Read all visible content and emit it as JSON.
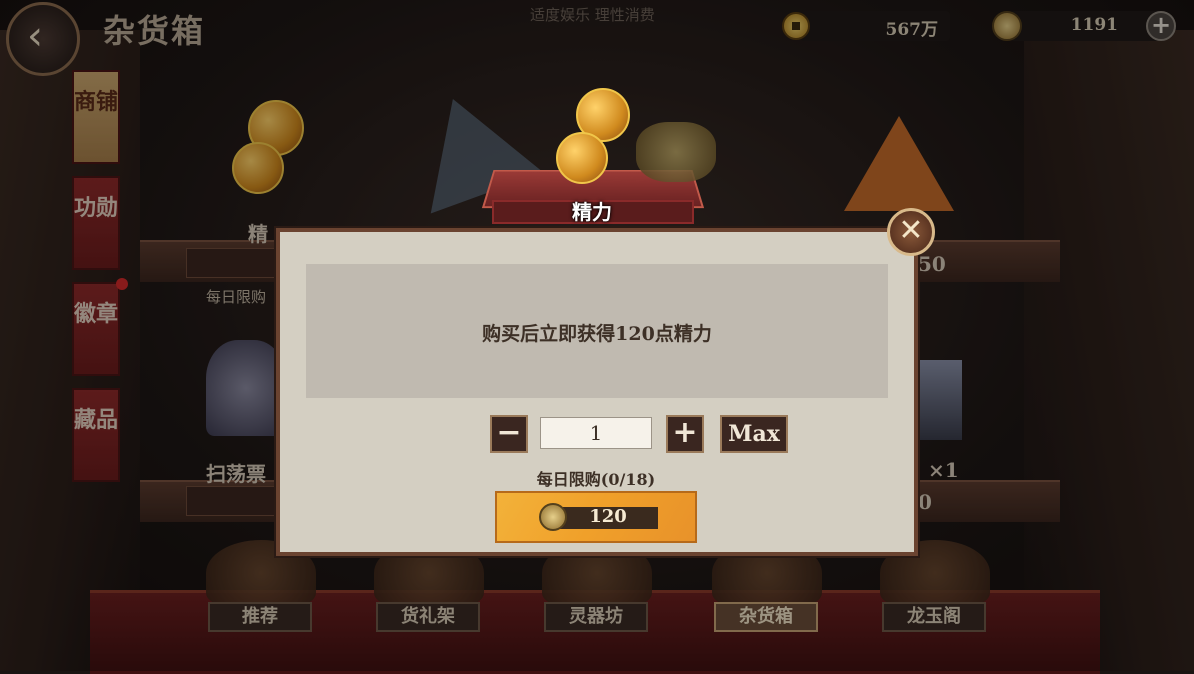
{
  "header": {
    "title": "杂货箱",
    "notice": "适度娱乐 理性消费",
    "coins": "567万",
    "jade": "1191"
  },
  "side_tabs": [
    {
      "label": "商铺",
      "active": true
    },
    {
      "label": "功勋",
      "active": false
    },
    {
      "label": "徽章",
      "active": false
    },
    {
      "label": "藏品",
      "active": false
    }
  ],
  "background_items": {
    "item1_label": "精",
    "item1_limit": "每日限购",
    "item2_label": "扫荡票",
    "right_price1": "50",
    "right_label2": "×1",
    "right_price2": "0"
  },
  "bottom_nav": [
    {
      "label": "推荐",
      "active": false
    },
    {
      "label": "货礼架",
      "active": false
    },
    {
      "label": "灵器坊",
      "active": false
    },
    {
      "label": "杂货箱",
      "active": true
    },
    {
      "label": "龙玉阁",
      "active": false
    }
  ],
  "modal": {
    "item_name": "精力",
    "description": "购买后立即获得120点精力",
    "quantity": "1",
    "minus": "−",
    "plus": "+",
    "max_label": "Max",
    "limit": "每日限购(0/18)",
    "price": "120",
    "close": "✕"
  }
}
